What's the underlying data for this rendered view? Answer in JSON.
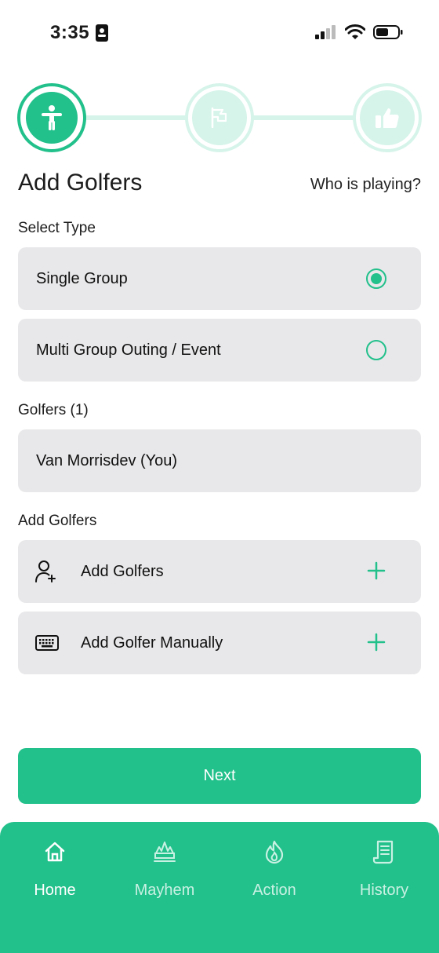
{
  "status_bar": {
    "time": "3:35"
  },
  "stepper": {
    "steps": [
      {
        "icon": "person-icon"
      },
      {
        "icon": "flag-icon"
      },
      {
        "icon": "thumbs-up-icon"
      }
    ],
    "active_index": 0
  },
  "header": {
    "title": "Add Golfers",
    "subtitle": "Who is playing?"
  },
  "select_type": {
    "label": "Select Type",
    "options": [
      {
        "label": "Single Group",
        "selected": true
      },
      {
        "label": "Multi Group Outing / Event",
        "selected": false
      }
    ]
  },
  "golfers": {
    "label": "Golfers (1)",
    "items": [
      "Van Morrisdev (You)"
    ]
  },
  "add_golfers": {
    "label": "Add Golfers",
    "actions": [
      {
        "label": "Add Golfers",
        "icon": "add-user-icon"
      },
      {
        "label": "Add Golfer Manually",
        "icon": "keyboard-icon"
      }
    ]
  },
  "next_button": {
    "label": "Next"
  },
  "tab_bar": {
    "tabs": [
      {
        "label": "Home",
        "icon": "home-icon",
        "active": true
      },
      {
        "label": "Mayhem",
        "icon": "mayhem-icon",
        "active": false
      },
      {
        "label": "Action",
        "icon": "flame-icon",
        "active": false
      },
      {
        "label": "History",
        "icon": "receipt-icon",
        "active": false
      }
    ]
  },
  "colors": {
    "accent": "#22c08b",
    "accent_light": "#d6f4ea",
    "card_bg": "#e8e8ea"
  }
}
